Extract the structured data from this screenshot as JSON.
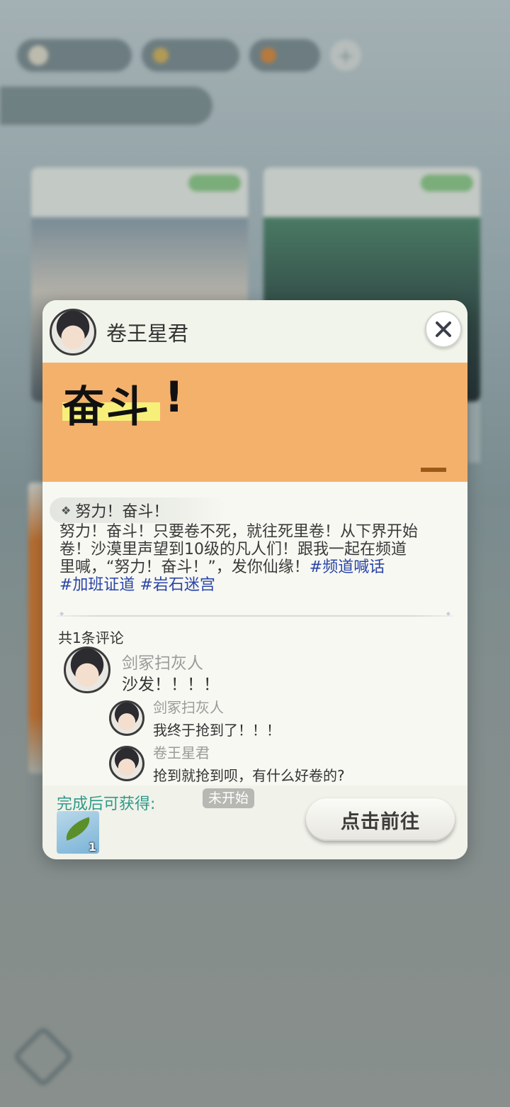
{
  "modal": {
    "author_name": "卷王星君",
    "banner_title": "奋斗",
    "banner_excl": "!",
    "tag": "努力！奋斗！",
    "body_lines": [
      "努力！奋斗！只要卷不死，就往死里卷！从下界开始",
      "卷！沙漠里声望到10级的凡人们！跟我一起在频道",
      "里喊，“努力！奋斗！”，发你仙缘！"
    ],
    "hashtags": [
      "#频道喊话",
      "#加班证道",
      "#岩石迷宫"
    ],
    "comment_count": "共1条评论",
    "comments": [
      {
        "name": "剑冢扫灰人",
        "text": "沙发！！！！"
      },
      {
        "name": "剑冢扫灰人",
        "text": "我终于抢到了！！！"
      },
      {
        "name": "卷王星君",
        "text": "抢到就抢到呗，有什么好卷的?"
      }
    ],
    "reward_label": "完成后可获得:",
    "status": "未开始",
    "reward_count": "1",
    "go_button": "点击前往"
  },
  "icons": {
    "close": "close-icon",
    "tag": "sparkle-icon",
    "reward": "leaf-icon"
  },
  "colors": {
    "banner": "#f4b16c",
    "highlight": "#f6f07a",
    "hashtag": "#2a44a8",
    "reward_label": "#2e9a88",
    "status_badge": "#b7b7b3"
  }
}
